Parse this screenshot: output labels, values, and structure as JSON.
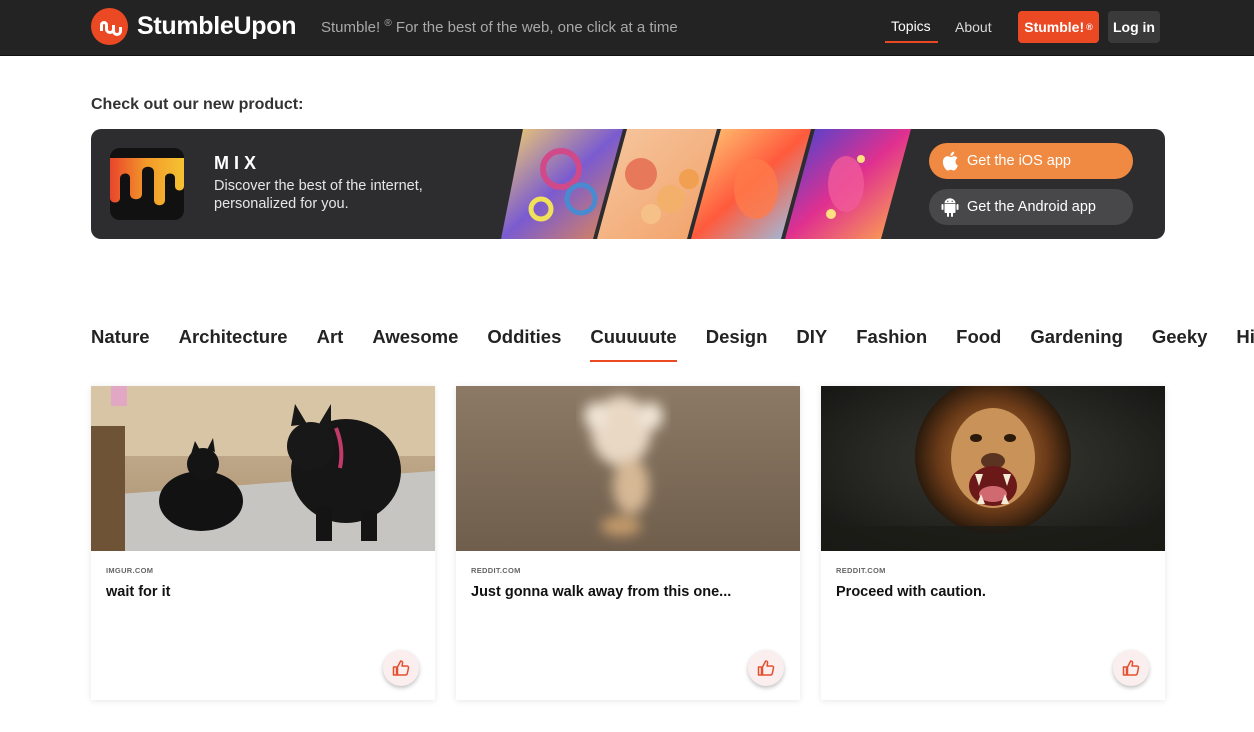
{
  "header": {
    "brand": "StumbleUpon",
    "tagline_prefix": "Stumble!",
    "tagline_reg": "®",
    "tagline_rest": " For the best of the web, one click at a time",
    "nav": {
      "topics": "Topics",
      "about": "About"
    },
    "stumble_button": "Stumble!",
    "stumble_reg": "®",
    "login_button": "Log in",
    "accent_color": "#eb4924"
  },
  "promo": {
    "heading": "Check out our new product:",
    "title": "MIX",
    "description": "Discover the best of the internet, personalized for you.",
    "ios_button": "Get the iOS app",
    "android_button": "Get the Android app"
  },
  "topics": {
    "items": [
      "Nature",
      "Architecture",
      "Art",
      "Awesome",
      "Oddities",
      "Cuuuuute",
      "Design",
      "DIY",
      "Fashion",
      "Food",
      "Gardening",
      "Geeky",
      "History"
    ],
    "active": "Cuuuuute"
  },
  "cards": [
    {
      "domain": "IMGUR.COM",
      "title": "wait for it",
      "image": "black-kittens"
    },
    {
      "domain": "REDDIT.COM",
      "title": "Just gonna walk away from this one...",
      "image": "blurry-dog"
    },
    {
      "domain": "REDDIT.COM",
      "title": "Proceed with caution.",
      "image": "roaring-lion"
    }
  ]
}
